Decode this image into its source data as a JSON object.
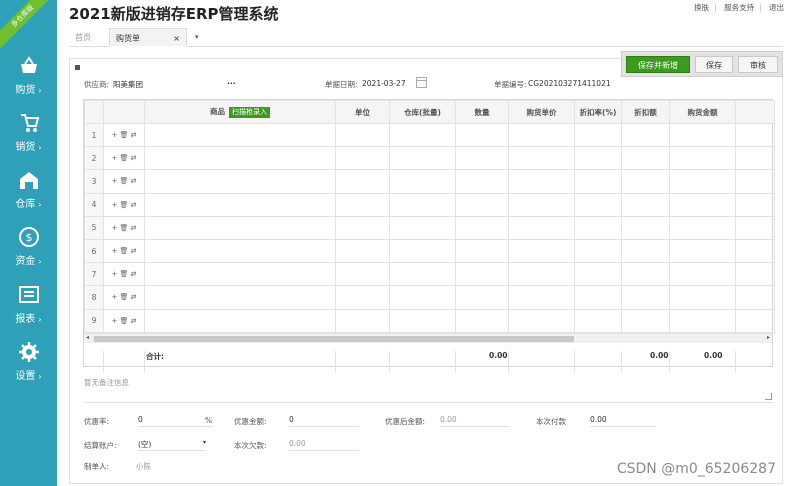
{
  "sidebar": {
    "ribbon": "多仓库版",
    "items": [
      {
        "label": "购货",
        "icon": "basket-icon"
      },
      {
        "label": "销货",
        "icon": "cart-icon"
      },
      {
        "label": "仓库",
        "icon": "warehouse-icon"
      },
      {
        "label": "资金",
        "icon": "money-icon"
      },
      {
        "label": "报表",
        "icon": "report-icon"
      },
      {
        "label": "设置",
        "icon": "gear-icon"
      }
    ]
  },
  "header": {
    "title": "2021新版进销存ERP管理系统",
    "links": [
      "换肤",
      "服务支持",
      "退出"
    ]
  },
  "tabs": {
    "home": "首页",
    "active": "购货单",
    "close": "×",
    "more": "▾"
  },
  "toolbar": {
    "save_new": "保存并新增",
    "save": "保存",
    "audit": "审核"
  },
  "form": {
    "supplier_label": "供应商:",
    "supplier_value": "阳美集团",
    "supplier_more": "···",
    "date_label": "单据日期:",
    "date_value": "2021-03-27",
    "doc_label": "单据编号:",
    "doc_value": "CG202103271411021"
  },
  "grid": {
    "columns": [
      "",
      "",
      "商品",
      "单位",
      "仓库(批量)",
      "数量",
      "购货单价",
      "折扣率(%)",
      "折扣额",
      "购货金额",
      ""
    ],
    "scan_label": "扫描枪录入",
    "rows": [
      "1",
      "2",
      "3",
      "4",
      "5",
      "6",
      "7",
      "8",
      "9"
    ],
    "row_ops": "+ 🗑 ⇄",
    "totals": {
      "label": "合计:",
      "qty": "0.00",
      "discount": "0.00",
      "amount": "0.00"
    }
  },
  "remark": {
    "placeholder": "暂无备注信息"
  },
  "footer": {
    "discount_rate_label": "优惠率:",
    "discount_rate_value": "0",
    "discount_rate_unit": "%",
    "discount_amount_label": "优惠金额:",
    "discount_amount_value": "0",
    "after_discount_label": "优惠后金额:",
    "after_discount_value": "0.00",
    "paid_label": "本次付款",
    "paid_value": "0.00",
    "account_label": "结算账户:",
    "account_value": "(空)",
    "debt_label": "本次欠款:",
    "debt_value": "0.00",
    "creator_label": "制单人:",
    "creator_value": "小陈"
  },
  "watermark": "CSDN @m0_65206287"
}
